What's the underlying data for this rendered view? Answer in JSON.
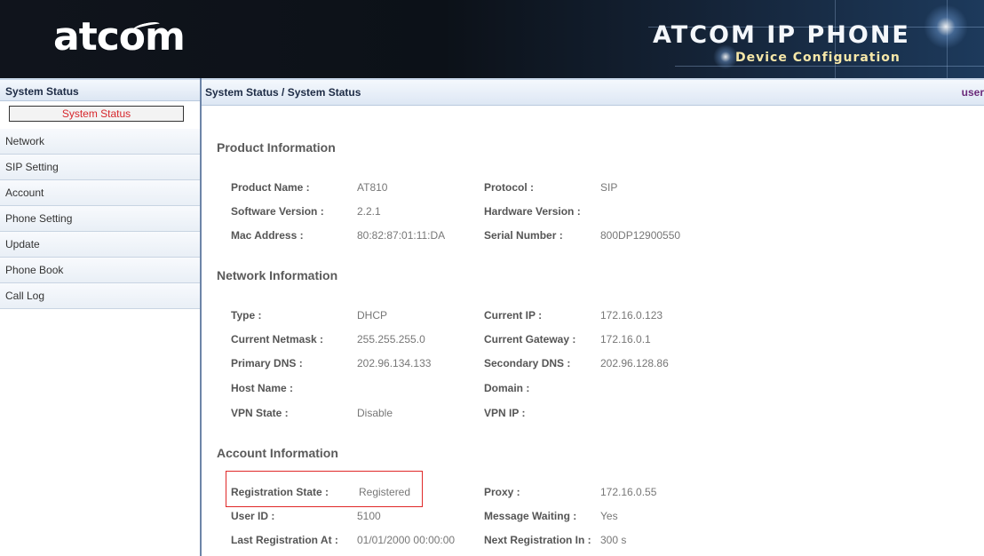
{
  "header": {
    "logo": "atcom",
    "brand_title": "ATCOM IP PHONE",
    "brand_subtitle": "Device Configuration"
  },
  "sidebar": {
    "heading": "System Status",
    "active_sub_item": "System Status",
    "items": [
      {
        "label": "Network"
      },
      {
        "label": "SIP Setting"
      },
      {
        "label": "Account"
      },
      {
        "label": "Phone Setting"
      },
      {
        "label": "Update"
      },
      {
        "label": "Phone Book"
      },
      {
        "label": "Call Log"
      }
    ]
  },
  "content": {
    "breadcrumb": "System Status / System Status",
    "user_label": "user",
    "product": {
      "title": "Product Information",
      "product_name_label": "Product Name :",
      "product_name": "AT810",
      "protocol_label": "Protocol :",
      "protocol": "SIP",
      "software_version_label": "Software Version :",
      "software_version": "2.2.1",
      "hardware_version_label": "Hardware Version :",
      "hardware_version": "",
      "mac_address_label": "Mac Address :",
      "mac_address": "80:82:87:01:11:DA",
      "serial_number_label": "Serial Number :",
      "serial_number": "800DP12900550"
    },
    "network": {
      "title": "Network Information",
      "type_label": "Type :",
      "type": "DHCP",
      "current_ip_label": "Current IP :",
      "current_ip": "172.16.0.123",
      "netmask_label": "Current Netmask :",
      "netmask": "255.255.255.0",
      "gateway_label": "Current Gateway :",
      "gateway": "172.16.0.1",
      "primary_dns_label": "Primary DNS :",
      "primary_dns": "202.96.134.133",
      "secondary_dns_label": "Secondary DNS :",
      "secondary_dns": "202.96.128.86",
      "host_name_label": "Host Name :",
      "host_name": "",
      "domain_label": "Domain :",
      "domain": "",
      "vpn_state_label": "VPN State :",
      "vpn_state": "Disable",
      "vpn_ip_label": "VPN IP :",
      "vpn_ip": ""
    },
    "account": {
      "title": "Account Information",
      "registration_state_label": "Registration State :",
      "registration_state": "Registered",
      "proxy_label": "Proxy :",
      "proxy": "172.16.0.55",
      "user_id_label": "User ID :",
      "user_id": "5100",
      "message_waiting_label": "Message Waiting :",
      "message_waiting": "Yes",
      "last_registration_label": "Last Registration At :",
      "last_registration": "01/01/2000 00:00:00",
      "next_registration_label": "Next Registration In :",
      "next_registration": "300 s"
    }
  }
}
